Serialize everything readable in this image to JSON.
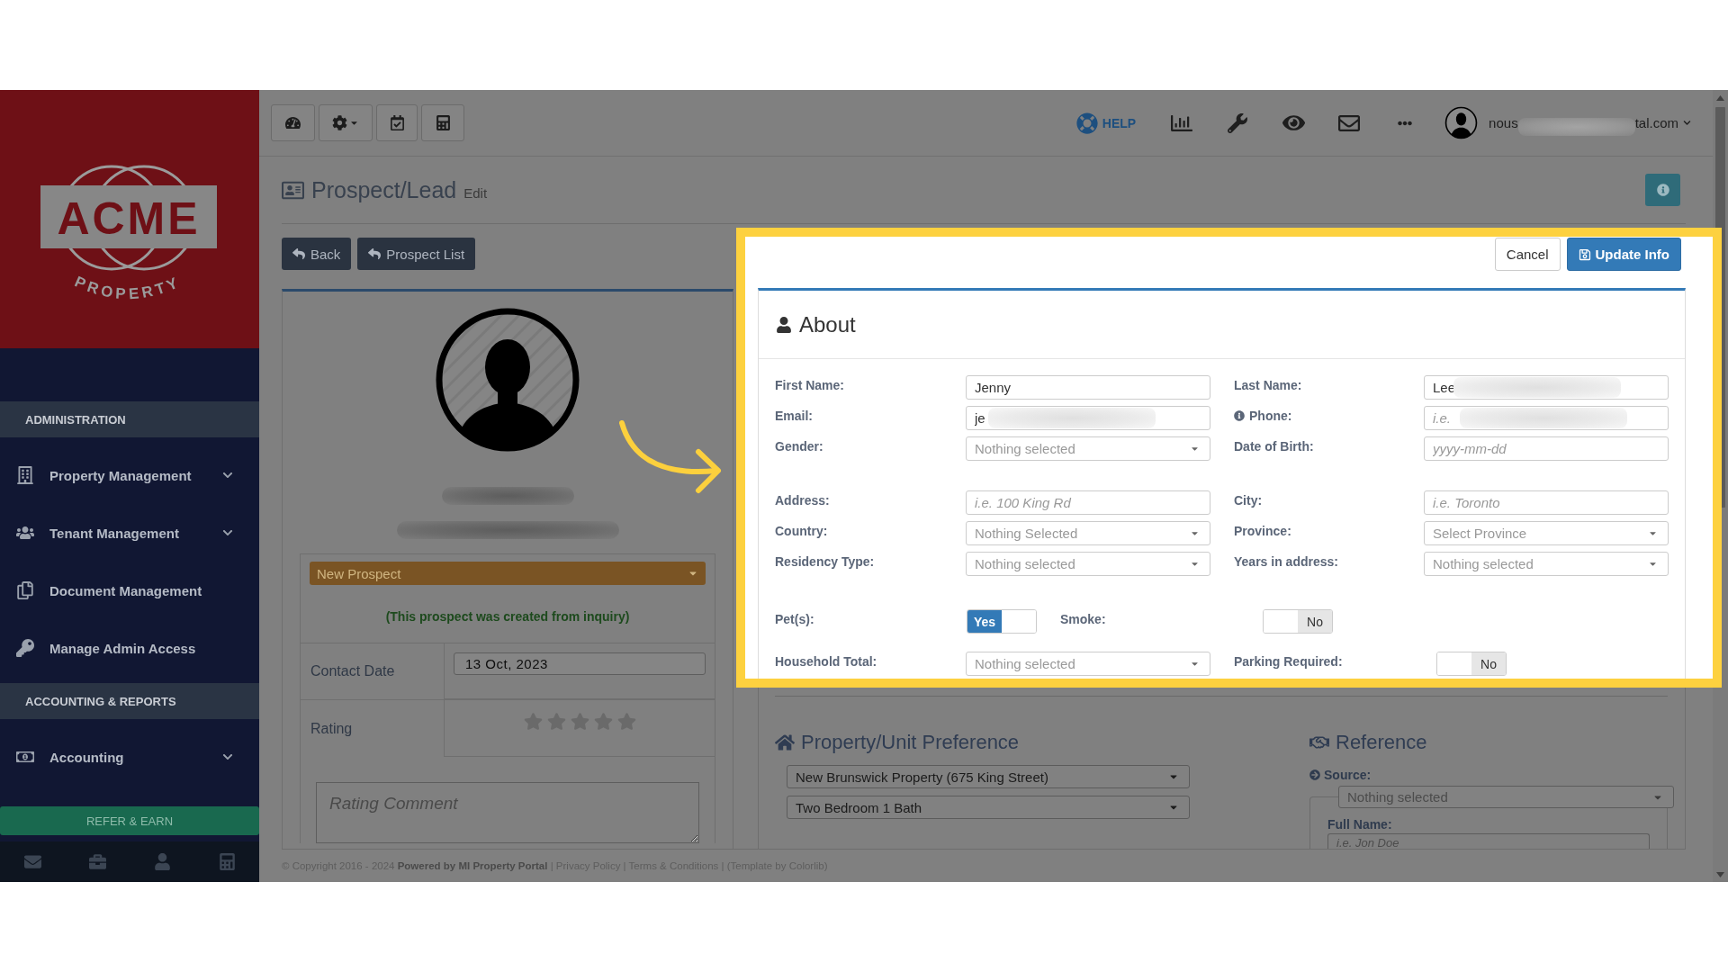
{
  "sidebar": {
    "logo": {
      "name": "ACME",
      "tagline": "PROPERTY"
    },
    "sections": [
      {
        "title": "ADMINISTRATION",
        "items": [
          {
            "label": "Property Management",
            "has_submenu": true
          },
          {
            "label": "Tenant Management",
            "has_submenu": true
          },
          {
            "label": "Document Management",
            "has_submenu": false
          },
          {
            "label": "Manage Admin Access",
            "has_submenu": false
          }
        ]
      },
      {
        "title": "ACCOUNTING & REPORTS",
        "items": [
          {
            "label": "Accounting",
            "has_submenu": true
          }
        ]
      }
    ],
    "refer_button": "REFER & EARN"
  },
  "topbar": {
    "help": "HELP",
    "user": {
      "email_start": "nous",
      "email_redacted": true,
      "email_end": "tal.com"
    }
  },
  "page_header": {
    "title": "Prospect/Lead",
    "subtitle": "Edit"
  },
  "nav_buttons": [
    "Back",
    "Prospect List"
  ],
  "profile": {
    "name_redacted": true,
    "email_redacted": true,
    "status": "New Prospect",
    "note": "(This prospect was created from inquiry)",
    "details": [
      {
        "kind": "date",
        "label": "Contact Date",
        "value": "13 Oct, 2023"
      },
      {
        "kind": "rating",
        "label": "Rating",
        "stars": 0
      }
    ],
    "comment_placeholder": "Rating Comment"
  },
  "form": {
    "actions": [
      {
        "label": "Cancel",
        "kind": "default"
      },
      {
        "label": "Update Info",
        "kind": "primary"
      }
    ],
    "about": {
      "title": "About",
      "groups": [
        {
          "rows": [
            [
              {
                "label": "First Name:",
                "kind": "text",
                "value": "Jenny"
              },
              {
                "label": "Last Name:",
                "kind": "text",
                "value": "Lee",
                "redacted": true
              }
            ],
            [
              {
                "label": "Email:",
                "kind": "text",
                "value": "je",
                "redacted": true
              },
              {
                "label": "Phone:",
                "kind": "text",
                "placeholder": "i.e.",
                "redacted": true,
                "info": true
              }
            ],
            [
              {
                "label": "Gender:",
                "kind": "select",
                "placeholder": "Nothing selected"
              },
              {
                "label": "Date of Birth:",
                "kind": "text",
                "placeholder": "yyyy-mm-dd"
              }
            ]
          ]
        },
        {
          "rows": [
            [
              {
                "label": "Address:",
                "kind": "text",
                "placeholder": "i.e. 100 King Rd"
              },
              {
                "label": "City:",
                "kind": "text",
                "placeholder": "i.e. Toronto"
              }
            ],
            [
              {
                "label": "Country:",
                "kind": "select",
                "placeholder": "Nothing Selected"
              },
              {
                "label": "Province:",
                "kind": "select",
                "placeholder": "Select Province"
              }
            ],
            [
              {
                "label": "Residency Type:",
                "kind": "select",
                "placeholder": "Nothing selected"
              },
              {
                "label": "Years in address:",
                "kind": "select",
                "placeholder": "Nothing selected"
              }
            ]
          ]
        },
        {
          "rows": [
            [
              {
                "label": "Pet(s):",
                "kind": "toggle",
                "on": true,
                "text": "Yes"
              },
              {
                "label": "Smoke:",
                "kind": "toggle",
                "on": false,
                "text": "No"
              }
            ],
            [
              {
                "label": "Household Total:",
                "kind": "select",
                "placeholder": "Nothing selected"
              },
              {
                "label": "Parking Required:",
                "kind": "toggle",
                "on": false,
                "text": "No"
              }
            ]
          ]
        }
      ]
    },
    "preference": {
      "title": "Property/Unit Preference",
      "selects": [
        "New Brunswick Property (675 King Street)",
        "Two Bedroom 1 Bath"
      ]
    },
    "reference": {
      "title": "Reference",
      "source": {
        "label": "Source:",
        "placeholder": "Nothing selected"
      },
      "full_name": {
        "label": "Full Name:",
        "placeholder": "i.e. Jon Doe"
      }
    }
  },
  "footer": "© Copyright 2016 - 2024 **Powered by MI Property Portal** | Privacy Policy | Terms & Conditions | (Template by Colorlib)"
}
